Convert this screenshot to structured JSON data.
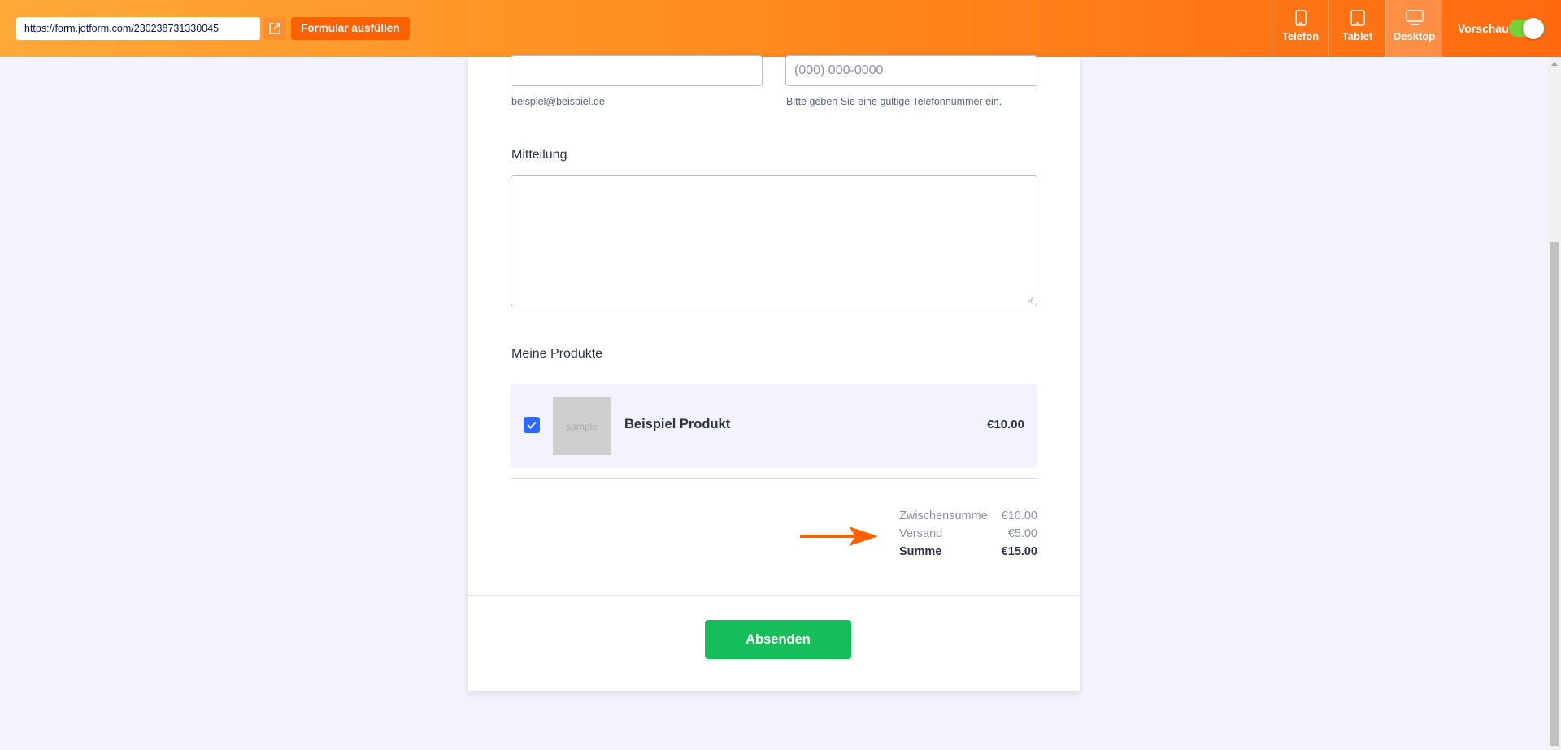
{
  "topbar": {
    "url": "https://form.jotform.com/230238731330045",
    "fill_button_label": "Formular ausfüllen",
    "external_link_icon": "external-link-icon",
    "devices": [
      {
        "label": "Telefon",
        "icon": "phone-icon",
        "active": false
      },
      {
        "label": "Tablet",
        "icon": "tablet-icon",
        "active": false
      },
      {
        "label": "Desktop",
        "icon": "desktop-icon",
        "active": true
      }
    ],
    "preview_label": "Vorschau",
    "preview_enabled": true
  },
  "form": {
    "email_sublabel": "beispiel@beispiel.de",
    "phone_placeholder": "(000) 000-0000",
    "phone_sublabel": "Bitte geben Sie eine gültige Telefonnummer ein.",
    "message_label": "Mitteilung",
    "products_label": "Meine Produkte",
    "product": {
      "checked": true,
      "image_text": "sample",
      "name": "Beispiel Produkt",
      "price": "€10.00"
    },
    "totals": [
      {
        "label": "Zwischensumme",
        "value": "€10.00"
      },
      {
        "label": "Versand",
        "value": "€5.00"
      },
      {
        "label": "Summe",
        "value": "€15.00"
      }
    ],
    "submit_label": "Absenden"
  },
  "colors": {
    "topbar_start": "#ffa83a",
    "topbar_end": "#ff6a10",
    "accent": "#ff6100",
    "submit": "#18bd5b",
    "checkbox": "#2e69ff",
    "toggle": "#78d236"
  }
}
